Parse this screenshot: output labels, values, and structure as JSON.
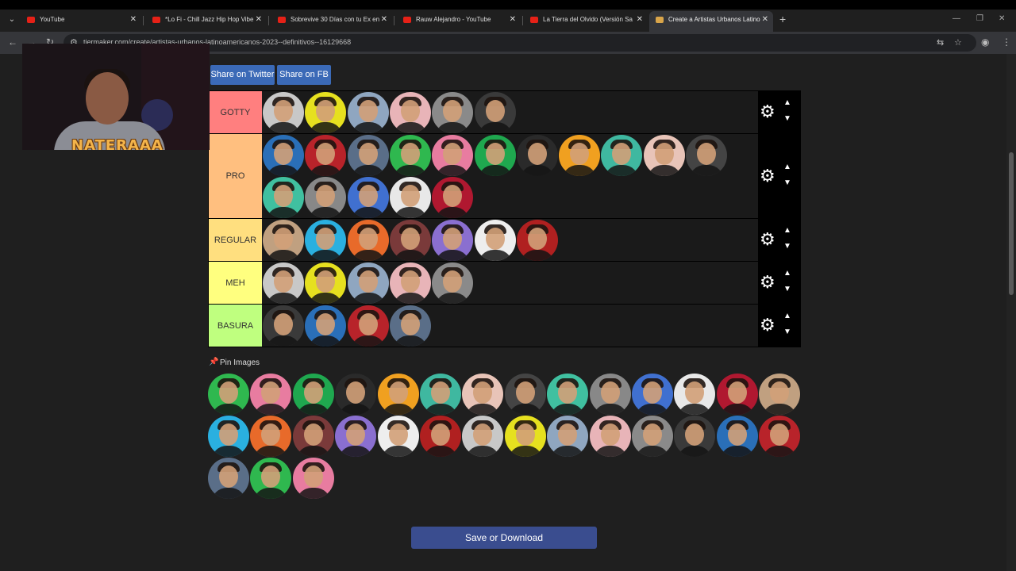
{
  "browser": {
    "tabs": [
      {
        "title": "YouTube",
        "icon": "youtube-icon",
        "color": "#e62117"
      },
      {
        "title": "*Lo Fi - Chill Jazz Hip Hop Vibe",
        "icon": "music-icon",
        "color": "#e62117"
      },
      {
        "title": "Sobrevive 30 Días con tu Ex en",
        "icon": "youtube-icon",
        "color": "#e62117"
      },
      {
        "title": "Rauw Alejandro - YouTube",
        "icon": "youtube-icon",
        "color": "#e62117"
      },
      {
        "title": "La Tierra del Olvido (Versión Sa",
        "icon": "youtube-icon",
        "color": "#e62117"
      },
      {
        "title": "Create a Artistas Urbanos Latino",
        "icon": "tiermaker-icon",
        "color": "#d9a54a"
      }
    ],
    "url": "tiermaker.com/create/artistas-urbanos-latinoamericanos-2023--definitivos--16129668"
  },
  "webcam": {
    "name": "NATERAAA"
  },
  "share": {
    "twitter": "Share on Twitter",
    "fb": "Share on FB"
  },
  "tiers": [
    {
      "label": "GOTTY",
      "color": "#ff7f7f",
      "items": 6
    },
    {
      "label": "PRO",
      "color": "#ffbf7f",
      "items": 16
    },
    {
      "label": "REGULAR",
      "color": "#ffdf7f",
      "items": 7
    },
    {
      "label": "MEH",
      "color": "#ffff7f",
      "items": 5
    },
    {
      "label": "BASURA",
      "color": "#bfff7f",
      "items": 4
    }
  ],
  "pin_label": "Pin Images",
  "pool_items": 31,
  "save_label": "Save or Download",
  "accent_colors": {
    "share_twitter": "#3b6ab7",
    "save": "#3a4d8f"
  }
}
